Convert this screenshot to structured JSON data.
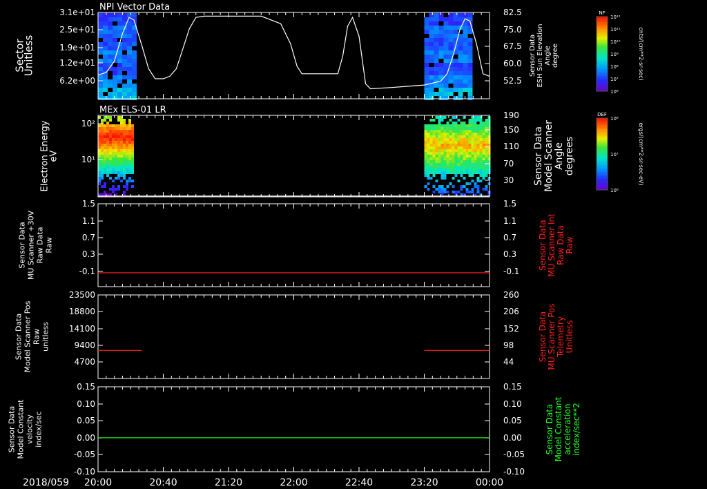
{
  "date_label": "2018/059",
  "time_ticks": [
    "20:00",
    "20:40",
    "21:20",
    "22:00",
    "22:40",
    "23:20",
    "00:00"
  ],
  "colors": {
    "white": "#ffffff",
    "red": "#ff2020",
    "green": "#20ff20"
  },
  "chart_data": [
    {
      "type": "heatmap",
      "title": "NPI Vector Data",
      "ylabel_left": [
        "Sector",
        "Unitless"
      ],
      "yticks_left": [
        "3.1e+01",
        "2.5e+01",
        "1.9e+01",
        "1.2e+01",
        "6.2e+00"
      ],
      "ylabel_right": [
        "Sensor Data",
        "ESH Sun Elevation",
        "Angle",
        "degree"
      ],
      "yticks_right": [
        "82.5",
        "75.0",
        "67.5",
        "60.0",
        "52.5"
      ],
      "ylim_right": [
        48,
        82.5
      ],
      "data_windows": [
        [
          "20:00",
          "20:23"
        ],
        [
          "23:20",
          "23:48"
        ]
      ],
      "overlay_line": {
        "color": "#ffffff",
        "x": [
          "20:00",
          "20:05",
          "20:10",
          "20:15",
          "20:19",
          "20:22",
          "20:27",
          "20:31",
          "20:35",
          "20:40",
          "20:44",
          "20:48",
          "20:52",
          "20:56",
          "21:00",
          "21:05",
          "21:10",
          "21:20",
          "21:40",
          "21:52",
          "21:58",
          "22:02",
          "22:05",
          "22:09",
          "22:20",
          "22:27",
          "22:30",
          "22:33",
          "22:36",
          "22:40",
          "22:44",
          "22:47",
          "23:00",
          "23:10",
          "23:20",
          "23:30",
          "23:34",
          "23:38",
          "23:42",
          "23:45",
          "23:48",
          "23:52",
          "23:56",
          "00:00"
        ],
        "y": [
          57.5,
          58.5,
          63,
          74,
          80.5,
          79.5,
          69,
          60,
          56,
          56,
          57,
          60,
          68,
          76,
          80.5,
          81,
          81,
          81,
          81,
          78,
          70,
          61,
          58,
          58,
          58,
          58,
          65,
          77,
          80.5,
          73,
          54,
          52,
          52.5,
          53,
          53.5,
          55,
          58,
          66,
          76,
          80,
          79,
          70,
          58,
          57
        ]
      },
      "colorbar": {
        "label": "NF",
        "unit": "cnts/(cm**2-sr-sec)",
        "ticks": [
          "10¹²",
          "10¹¹",
          "10¹⁰",
          "10⁹",
          "10⁸",
          "10⁷",
          "10⁶"
        ]
      }
    },
    {
      "type": "heatmap",
      "title": "MEx ELS-01 LR",
      "ylabel_left": [
        "Electron Energy",
        "eV"
      ],
      "yticks_left": [
        "10²",
        "10¹"
      ],
      "ylabel_right": [
        "Sensor Data",
        "Model Scanner",
        "Angle",
        "degrees"
      ],
      "yticks_right": [
        "190",
        "150",
        "110",
        "70",
        "30"
      ],
      "ylim_right": [
        0,
        190
      ],
      "overlay_line": {
        "color": "#ffffff",
        "x": [
          "20:00",
          "00:00"
        ],
        "y": [
          2,
          2
        ]
      },
      "data_windows": [
        [
          "20:00",
          "20:21"
        ],
        [
          "23:20",
          "00:00"
        ]
      ],
      "colorbar": {
        "label": "DEF",
        "unit": "ergs/(cm**2-sr-sec-eV)",
        "ticks": [
          "10⁸",
          "10⁷",
          "10⁶"
        ]
      }
    },
    {
      "type": "line",
      "ylabel_left": [
        "Sensor Data",
        "MU Scanner +30V",
        "Raw Data",
        "Raw"
      ],
      "yticks_left": [
        "1.5",
        "1.1",
        "0.7",
        "0.3",
        "-0.1"
      ],
      "ylim": [
        -0.3,
        1.5
      ],
      "ylabel_right": [
        "Sensor Data",
        "MU Scanner Int",
        "Raw Data",
        "Raw"
      ],
      "yticks_right": [
        "1.5",
        "1.1",
        "0.7",
        "0.3",
        "-0.1"
      ],
      "series": [
        {
          "color": "#ff2020",
          "x": [
            "20:00",
            "00:00"
          ],
          "y": [
            0,
            0
          ]
        }
      ]
    },
    {
      "type": "line",
      "ylabel_left": [
        "Sensor Data",
        "Model Scanner Pos",
        "Raw",
        "unitless"
      ],
      "yticks_left": [
        "23500",
        "18800",
        "14100",
        "9400",
        "4700"
      ],
      "ylim": [
        0,
        23500
      ],
      "ylabel_right": [
        "Sensor Data",
        "MU Scanner Pos",
        "Telemetry",
        "Unitless"
      ],
      "yticks_right": [
        "260",
        "206",
        "152",
        "98",
        "44"
      ],
      "series": [
        {
          "color": "#ff2020",
          "x": [
            "20:00",
            "20:27"
          ],
          "y": [
            7900,
            7900
          ]
        },
        {
          "color": "#ff2020",
          "x": [
            "23:20",
            "00:00"
          ],
          "y": [
            7900,
            7900
          ]
        }
      ]
    },
    {
      "type": "line",
      "ylabel_left": [
        "Sensor Data",
        "Model Constant",
        "velocity",
        "index/sec"
      ],
      "yticks_left": [
        "0.15",
        "0.10",
        "0.05",
        "0.00",
        "-0.05",
        "-0.10"
      ],
      "ylim": [
        -0.1,
        0.15
      ],
      "ylabel_right": [
        "Sensor Data",
        "Model Constant",
        "acceleration",
        "index/sec**2"
      ],
      "yticks_right": [
        "0.15",
        "0.10",
        "0.05",
        "0.00",
        "-0.05",
        "-0.10"
      ],
      "series": [
        {
          "color": "#20ff20",
          "x": [
            "20:00",
            "00:00"
          ],
          "y": [
            0,
            0
          ]
        }
      ]
    }
  ]
}
